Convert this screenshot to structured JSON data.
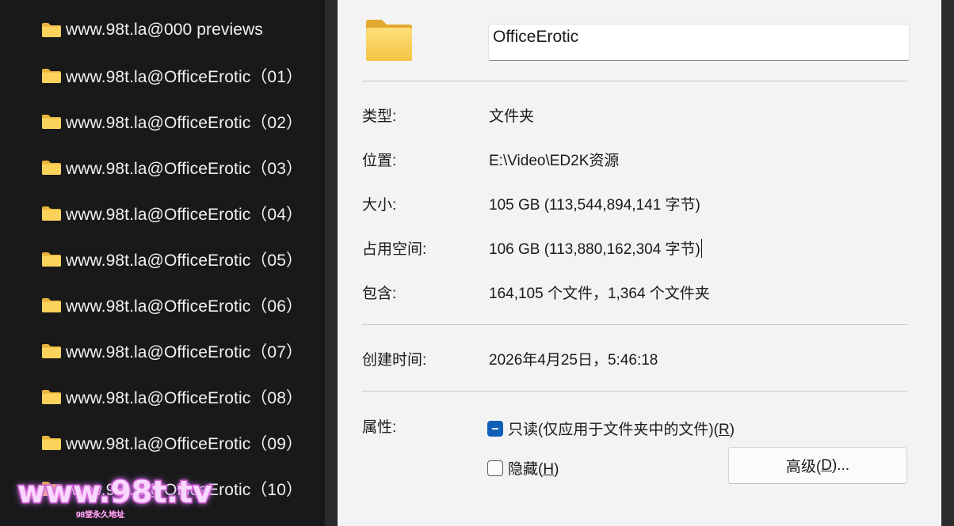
{
  "explorer": {
    "folders": [
      "www.98t.la@000 previews",
      "www.98t.la@OfficeErotic（01）",
      "www.98t.la@OfficeErotic（02）",
      "www.98t.la@OfficeErotic（03）",
      "www.98t.la@OfficeErotic（04）",
      "www.98t.la@OfficeErotic（05）",
      "www.98t.la@OfficeErotic（06）",
      "www.98t.la@OfficeErotic（07）",
      "www.98t.la@OfficeErotic（08）",
      "www.98t.la@OfficeErotic（09）",
      "www.98t.la@OfficeErotic（10）"
    ],
    "watermark": {
      "text": "www.98t.tv",
      "subtext": "98堂永久地址"
    }
  },
  "properties": {
    "folder_name": "OfficeErotic",
    "type": {
      "label": "类型:",
      "value": "文件夹"
    },
    "location": {
      "label": "位置:",
      "value": "E:\\Video\\ED2K资源"
    },
    "size": {
      "label": "大小:",
      "value": "105 GB (113,544,894,141 字节)"
    },
    "size_on_disk": {
      "label": "占用空间:",
      "value": "106 GB (113,880,162,304 字节)"
    },
    "contains": {
      "label": "包含:",
      "value": "164,105 个文件，1,364 个文件夹"
    },
    "created": {
      "label": "创建时间:",
      "value": "2026年4月25日，5:46:18"
    },
    "attributes": {
      "label": "属性:",
      "readonly_text": "只读(仅应用于文件夹中的文件)(",
      "readonly_key": "R",
      "readonly_end": ")",
      "hidden_text": "隐藏(",
      "hidden_key": "H",
      "hidden_end": ")",
      "advanced_text": "高级(",
      "advanced_key": "D",
      "advanced_end": ")..."
    }
  },
  "colors": {
    "folder_yellow": "#f8c94a",
    "checkbox_accent": "#0f5fb8"
  }
}
